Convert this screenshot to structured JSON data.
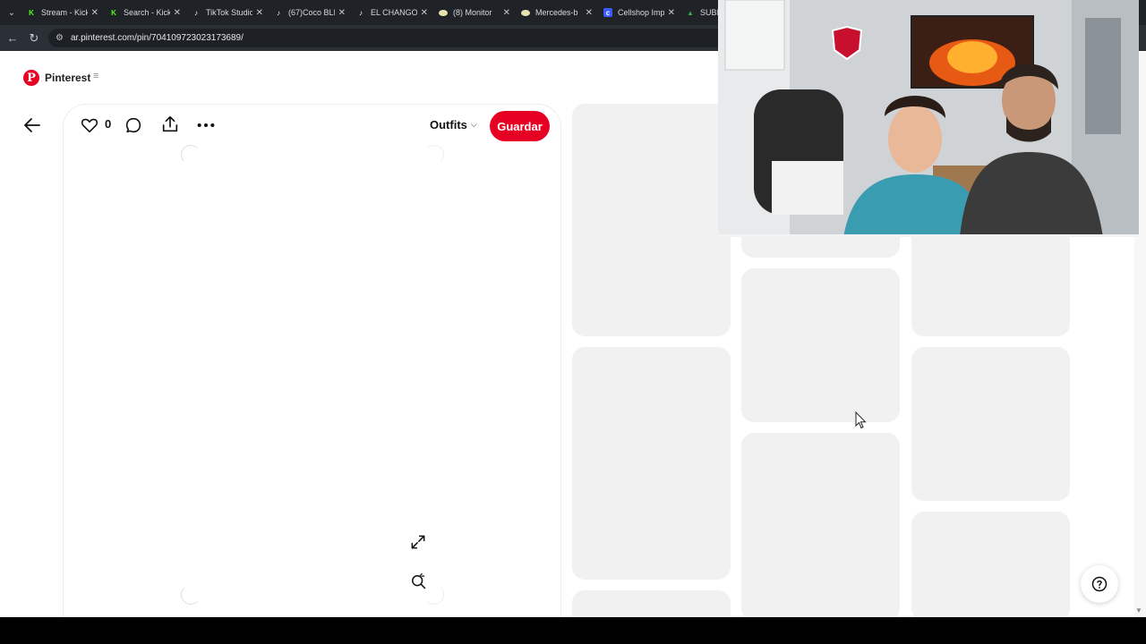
{
  "browser": {
    "tabs": [
      {
        "title": "Stream - Kick",
        "icon": "kick-icon",
        "icon_color": "#53fc18"
      },
      {
        "title": "Search - Kick",
        "icon": "kick-icon",
        "icon_color": "#53fc18"
      },
      {
        "title": "TikTok Studio",
        "icon": "tiktok-icon",
        "icon_color": "#ffffff"
      },
      {
        "title": "(67)Coco BLI",
        "icon": "tiktok-icon",
        "icon_color": "#ffffff"
      },
      {
        "title": "EL CHANGO",
        "icon": "tiktok-icon",
        "icon_color": "#ffffff"
      },
      {
        "title": "(8) Monitor",
        "icon": "globe-icon",
        "icon_color": "#e8e2b0"
      },
      {
        "title": "Mercedes-b",
        "icon": "globe-icon",
        "icon_color": "#e8e2b0"
      },
      {
        "title": "Cellshop Imp",
        "icon": "cellshop-icon",
        "icon_color": "#3d5afe"
      },
      {
        "title": "SUBI",
        "icon": "drive-icon",
        "icon_color": "#34a853"
      }
    ],
    "url": "ar.pinterest.com/pin/704109723023173689/"
  },
  "pinterest": {
    "brand": "Pinterest",
    "like_count": "0",
    "board": "Outfits",
    "save_label": "Guardar"
  },
  "colors": {
    "brand_red": "#e60023",
    "placeholder": "#f1f1f1"
  }
}
